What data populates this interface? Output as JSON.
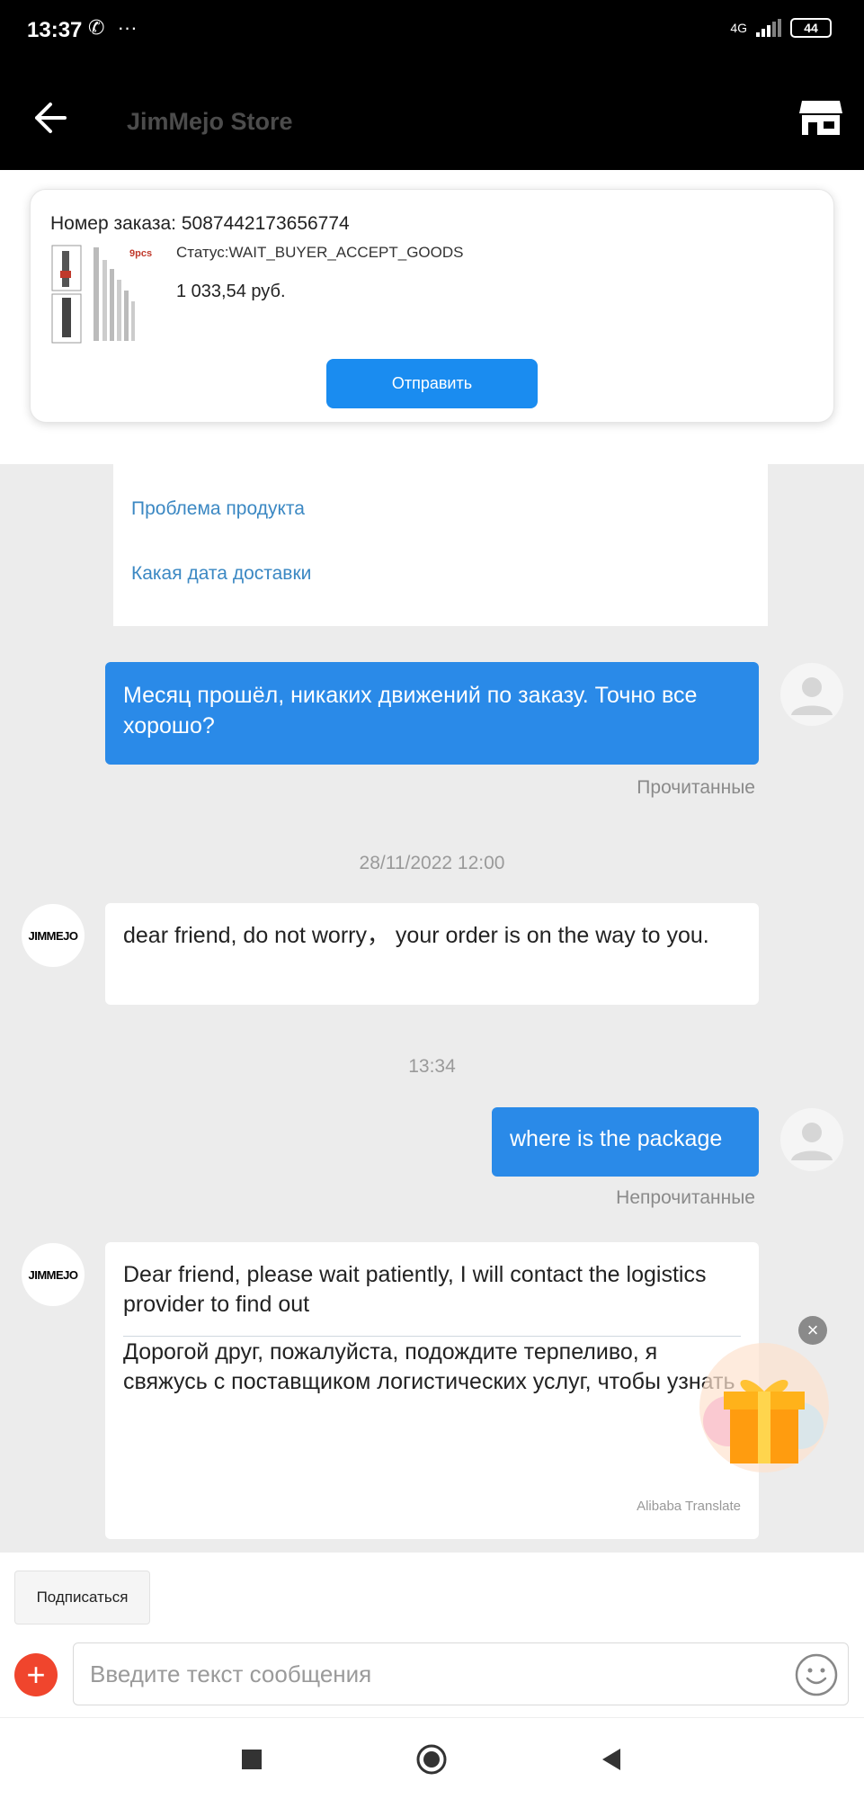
{
  "status_bar": {
    "time": "13:37",
    "network": "4G",
    "battery": "44"
  },
  "header": {
    "title": "JimMejo Store"
  },
  "order": {
    "number": "Номер заказа: 5087442173656774",
    "status": "Статус:WAIT_BUYER_ACCEPT_GOODS",
    "price": "1 033,54 руб.",
    "image_caption": "9pcs",
    "send_label": "Отправить"
  },
  "quick_questions": [
    "Проблема продукта",
    "Какая дата доставки"
  ],
  "messages": [
    {
      "side": "out",
      "text": "Месяц прошёл, никаких движений по заказу. Точно все хорошо?",
      "status": "Прочитанные"
    },
    {
      "timestamp": "28/11/2022 12:00"
    },
    {
      "side": "in",
      "text": "dear friend, do not worry， your order is on the way to you."
    },
    {
      "timestamp": "13:34"
    },
    {
      "side": "out",
      "text": "where is the package",
      "status": "Непрочитанные"
    },
    {
      "side": "in",
      "text": "Dear friend, please wait patiently, I will contact the logistics provider to find out",
      "translation": "Дорогой друг, пожалуйста, подождите терпеливо, я свяжусь с поставщиком логистических услуг, чтобы узнать",
      "translate_label": "Alibaba Translate"
    }
  ],
  "store_avatar_text": "JIMMEJO",
  "bottom": {
    "subscribe_label": "Подписаться",
    "input_placeholder": "Введите текст сообщения"
  },
  "colors": {
    "accent": "#1a8cf0",
    "bubble_out": "#2a8ae8",
    "link": "#3b88c3",
    "plus": "#f0452d"
  }
}
